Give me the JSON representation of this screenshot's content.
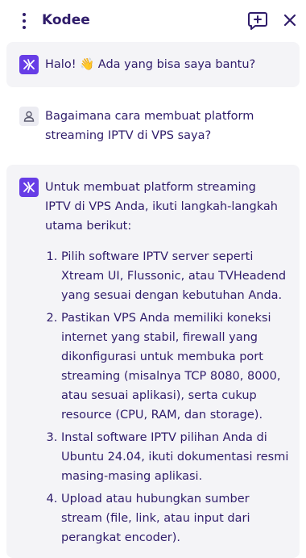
{
  "header": {
    "title": "Kodee",
    "menu_icon": "kebab-menu-icon",
    "new_chat_icon": "new-chat-icon",
    "close_icon": "close-icon"
  },
  "messages": [
    {
      "role": "bot",
      "text": "Halo! 👋 Ada yang bisa saya bantu?"
    },
    {
      "role": "user",
      "text": "Bagaimana cara membuat platform streaming IPTV di VPS saya?"
    },
    {
      "role": "bot",
      "intro": "Untuk membuat platform streaming IPTV di VPS Anda, ikuti langkah-langkah utama berikut:",
      "steps": [
        "Pilih software IPTV server seperti Xtream UI, Flussonic, atau TVHeadend yang sesuai dengan kebutuhan Anda.",
        "Pastikan VPS Anda memiliki koneksi internet yang stabil, firewall yang dikonfigurasi untuk membuka port streaming (misalnya TCP 8080, 8000, atau sesuai aplikasi), serta cukup resource (CPU, RAM, dan storage).",
        "Instal software IPTV pilihan Anda di Ubuntu 24.04, ikuti dokumentasi resmi masing-masing aplikasi.",
        "Upload atau hubungkan sumber stream (file, link, atau input dari perangkat encoder)."
      ]
    }
  ],
  "colors": {
    "accent": "#673de6",
    "text": "#2f1c6a",
    "bubble_bg": "#f4f4f7"
  }
}
